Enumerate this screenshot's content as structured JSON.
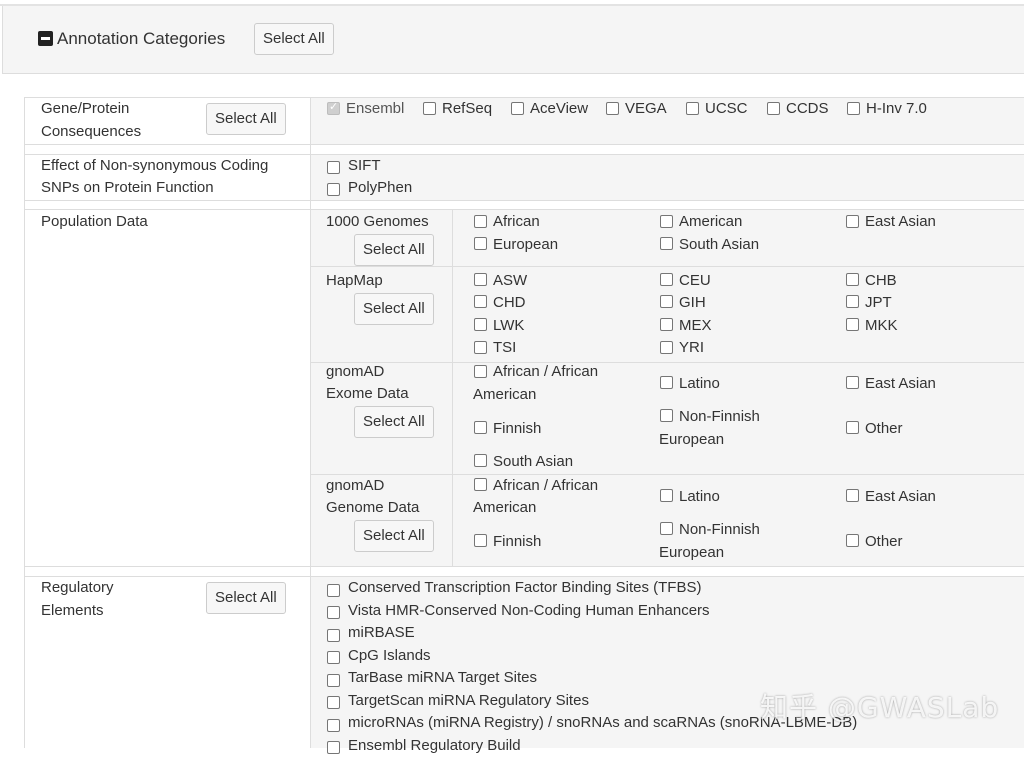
{
  "panel": {
    "title": "Annotation Categories",
    "select_all": "Select All"
  },
  "gene_protein": {
    "label_line1": "Gene/Protein",
    "label_line2": "Consequences",
    "select_all": "Select All",
    "options": [
      {
        "label": "Ensembl",
        "checked": true,
        "disabled": true
      },
      {
        "label": "RefSeq",
        "checked": false
      },
      {
        "label": "AceView",
        "checked": false
      },
      {
        "label": "VEGA",
        "checked": false
      },
      {
        "label": "UCSC",
        "checked": false
      },
      {
        "label": "CCDS",
        "checked": false
      },
      {
        "label": "H-Inv 7.0",
        "checked": false
      }
    ]
  },
  "nonsyn": {
    "label_line1": "Effect of Non-synonymous Coding",
    "label_line2": "SNPs on Protein Function",
    "options": [
      {
        "label": "SIFT",
        "checked": false
      },
      {
        "label": "PolyPhen",
        "checked": false
      }
    ]
  },
  "population": {
    "label": "Population Data",
    "select_all": "Select All",
    "genomes_1000": {
      "label": "1000 Genomes",
      "options": [
        "African",
        "American",
        "East Asian",
        "European",
        "South Asian"
      ]
    },
    "hapmap": {
      "label": "HapMap",
      "options": [
        "ASW",
        "CEU",
        "CHB",
        "CHD",
        "GIH",
        "JPT",
        "LWK",
        "MEX",
        "MKK",
        "TSI",
        "YRI"
      ]
    },
    "gnomad_exome": {
      "label_line1": "gnomAD",
      "label_line2": "Exome Data",
      "options": {
        "african_1": "African / African",
        "african_2": "American",
        "latino": "Latino",
        "east_asian": "East Asian",
        "nonfinnish_1": "Non-Finnish",
        "nonfinnish_2": "European",
        "finnish": "Finnish",
        "other": "Other",
        "south_asian": "South Asian"
      }
    },
    "gnomad_genome": {
      "label_line1": "gnomAD",
      "label_line2": "Genome Data",
      "options": {
        "african_1": "African / African",
        "african_2": "American",
        "latino": "Latino",
        "east_asian": "East Asian",
        "nonfinnish_1": "Non-Finnish",
        "nonfinnish_2": "European",
        "finnish": "Finnish",
        "other": "Other"
      }
    }
  },
  "regulatory": {
    "label_line1": "Regulatory",
    "label_line2": "Elements",
    "select_all": "Select All",
    "options": [
      "Conserved Transcription Factor Binding Sites (TFBS)",
      "Vista HMR-Conserved Non-Coding Human Enhancers",
      "miRBASE",
      "CpG Islands",
      "TarBase miRNA Target Sites",
      "TargetScan miRNA Regulatory Sites",
      "microRNAs (miRNA Registry) / snoRNAs and scaRNAs (snoRNA-LBME-DB)",
      "Ensembl Regulatory Build"
    ]
  },
  "watermark": "知乎 @GWASLab"
}
